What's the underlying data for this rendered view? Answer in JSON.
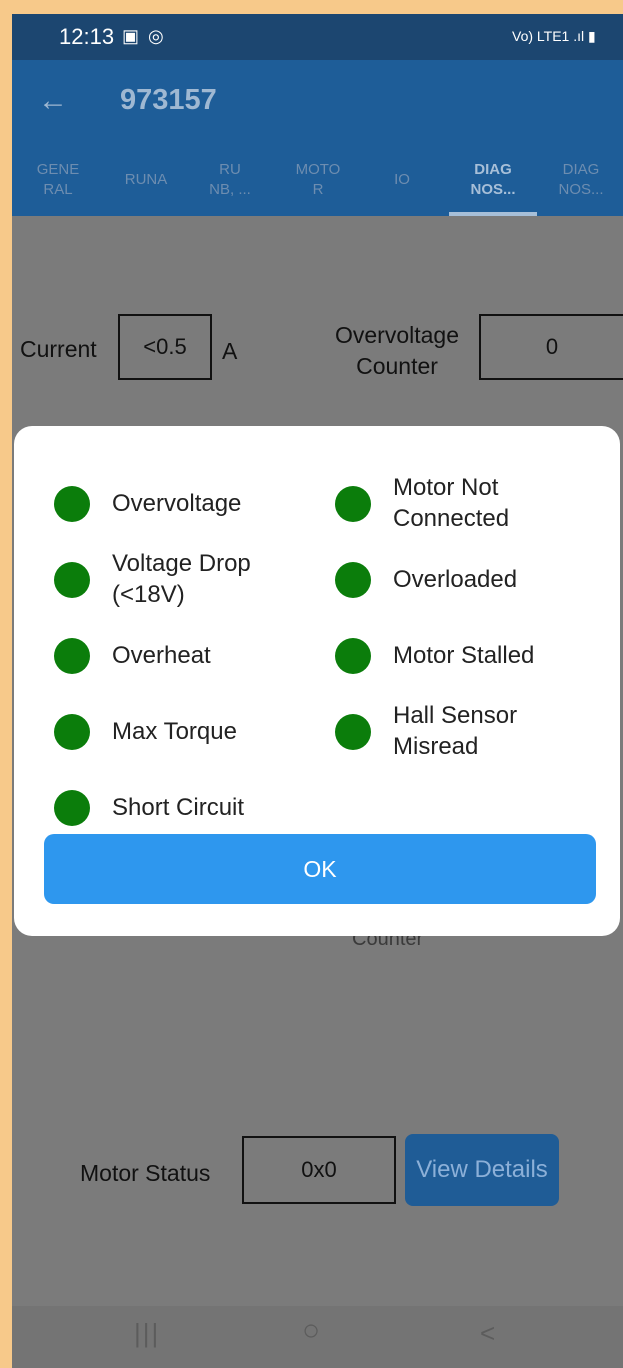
{
  "status_bar": {
    "time": "12:13",
    "right_icons": "Vo) LTE1 .ıl ▮",
    "colors": {
      "bg": "#1c4670"
    }
  },
  "app_bar": {
    "title": "973157",
    "back_icon": "arrow-left"
  },
  "tabs": [
    {
      "label": "GENE\nRAL",
      "active": false
    },
    {
      "label": "RUNA",
      "active": false
    },
    {
      "label": "RU\nNB, ...",
      "active": false
    },
    {
      "label": "MOTO\nR",
      "active": false
    },
    {
      "label": "IO",
      "active": false
    },
    {
      "label": "DIAG\nNOS...",
      "active": true
    },
    {
      "label": "DIAG\nNOS...",
      "active": false
    }
  ],
  "diagnostics": {
    "current_label": "Current",
    "current_value": "<0.5",
    "current_unit": "A",
    "overvoltage_counter_label": "Overvoltage\nCounter",
    "overvoltage_counter_value": "0",
    "partial_label": "Counter",
    "motor_status_label": "Motor Status",
    "motor_status_value": "0x0",
    "view_details_label": "View Details"
  },
  "dialog": {
    "indicators": [
      {
        "label": "Overvoltage",
        "color": "#0b7d0b"
      },
      {
        "label": "Motor Not\nConnected",
        "color": "#0b7d0b"
      },
      {
        "label": "Voltage Drop\n(<18V)",
        "color": "#0b7d0b"
      },
      {
        "label": "Overloaded",
        "color": "#0b7d0b"
      },
      {
        "label": "Overheat",
        "color": "#0b7d0b"
      },
      {
        "label": "Motor Stalled",
        "color": "#0b7d0b"
      },
      {
        "label": "Max Torque",
        "color": "#0b7d0b"
      },
      {
        "label": "Hall Sensor\nMisread",
        "color": "#0b7d0b"
      },
      {
        "label": "Short Circuit",
        "color": "#0b7d0b"
      }
    ],
    "ok_label": "OK"
  },
  "nav_bar": {
    "recents": "|||",
    "home": "○",
    "back": "<"
  }
}
